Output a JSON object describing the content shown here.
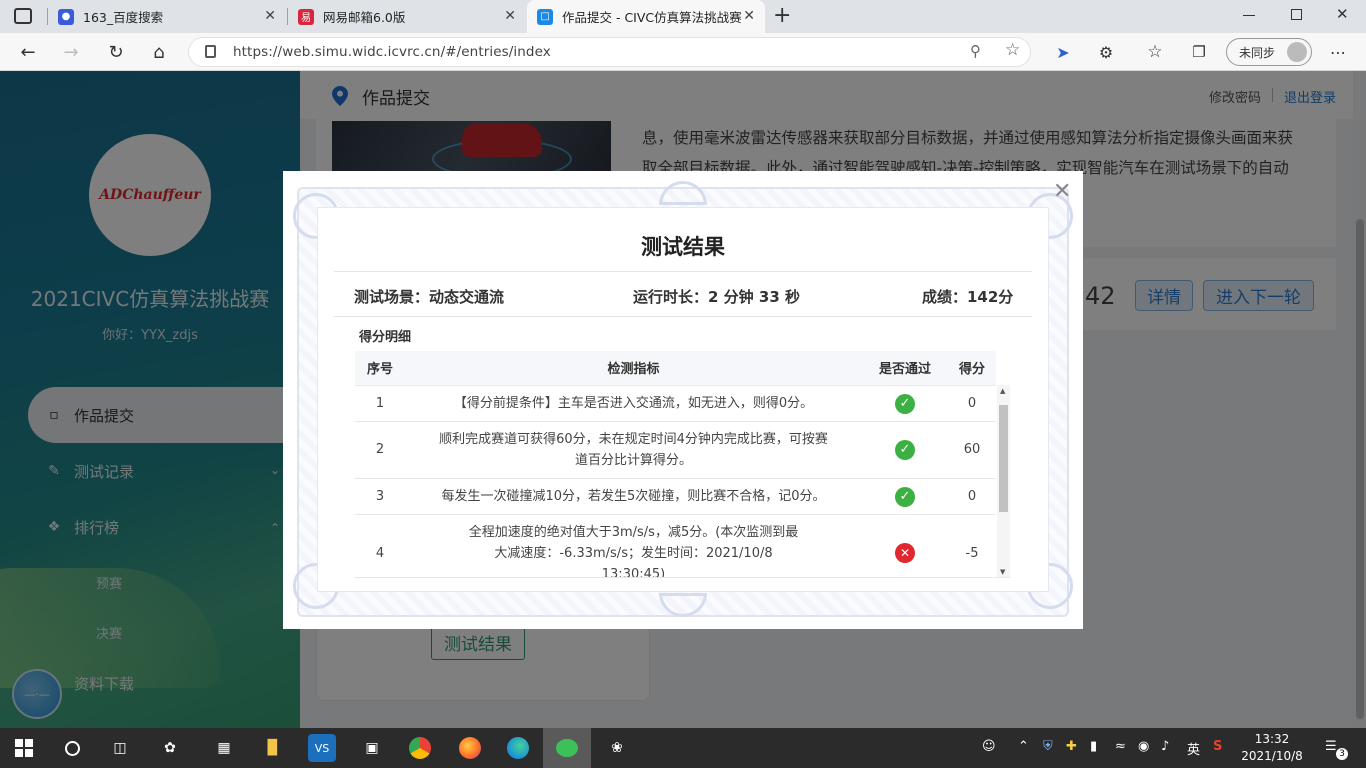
{
  "browser": {
    "tabs": [
      {
        "title": "163_百度搜索",
        "favicon_color": "#3b5bdb"
      },
      {
        "title": "网易邮箱6.0版",
        "favicon_color": "#d7263d"
      },
      {
        "title": "作品提交 - CIVC仿真算法挑战赛",
        "favicon_color": "#1e88e5"
      }
    ],
    "new_tab": "+",
    "url": "https://web.simu.widc.icvrc.cn/#/entries/index",
    "sync_label": "未同步"
  },
  "sidebar": {
    "logo_text": "ADChauffeur",
    "site_title": "2021CIVC仿真算法挑战赛",
    "greeting": "你好：YYX_zdjs",
    "menu": [
      {
        "label": "作品提交"
      },
      {
        "label": "测试记录"
      },
      {
        "label": "排行榜"
      },
      {
        "label": "资料下载"
      }
    ],
    "submenu": [
      "预赛",
      "决赛"
    ]
  },
  "header": {
    "title": "作品提交",
    "change_password": "修改密码",
    "logout": "退出登录"
  },
  "background": {
    "intro_lines": [
      "息，使用毫米波雷达传感器来获取部分目标数据，并通过使用感知算法分析指定摄像头画面来获",
      "取全部目标数据。此外，通过智能驾驶感知-决策-控制策略，实现智能汽车在测试场景下的自动"
    ],
    "score_partial": "42",
    "details_button": "详情",
    "next_round_button": "进入下一轮",
    "test_result_button": "测试结果"
  },
  "modal": {
    "title": "测试结果",
    "summary": {
      "scene": "测试场景：动态交通流",
      "duration": "运行时长：2 分钟 33 秒",
      "score": "成绩：142分"
    },
    "detail_title": "得分明细",
    "columns": [
      "序号",
      "检测指标",
      "是否通过",
      "得分"
    ],
    "rows": [
      {
        "no": "1",
        "indicator": "【得分前提条件】主车是否进入交通流，如无进入，则得0分。",
        "passed": true,
        "score": "0"
      },
      {
        "no": "2",
        "indicator": "顺利完成赛道可获得60分，未在规定时间4分钟内完成比赛，可按赛道百分比计算得分。",
        "passed": true,
        "score": "60"
      },
      {
        "no": "3",
        "indicator": "每发生一次碰撞减10分，若发生5次碰撞，则比赛不合格，记0分。",
        "passed": true,
        "score": "0"
      },
      {
        "no": "4",
        "indicator": "全程加速度的绝对值大于3m/s/s，减5分。(本次监测到最大减速度：-6.33m/s/s；发生时间：2021/10/8 13:30:45)",
        "passed": false,
        "score": "-5"
      }
    ]
  },
  "taskbar": {
    "time": "13:32",
    "date": "2021/10/8",
    "ime": "英",
    "notifications": "3"
  }
}
